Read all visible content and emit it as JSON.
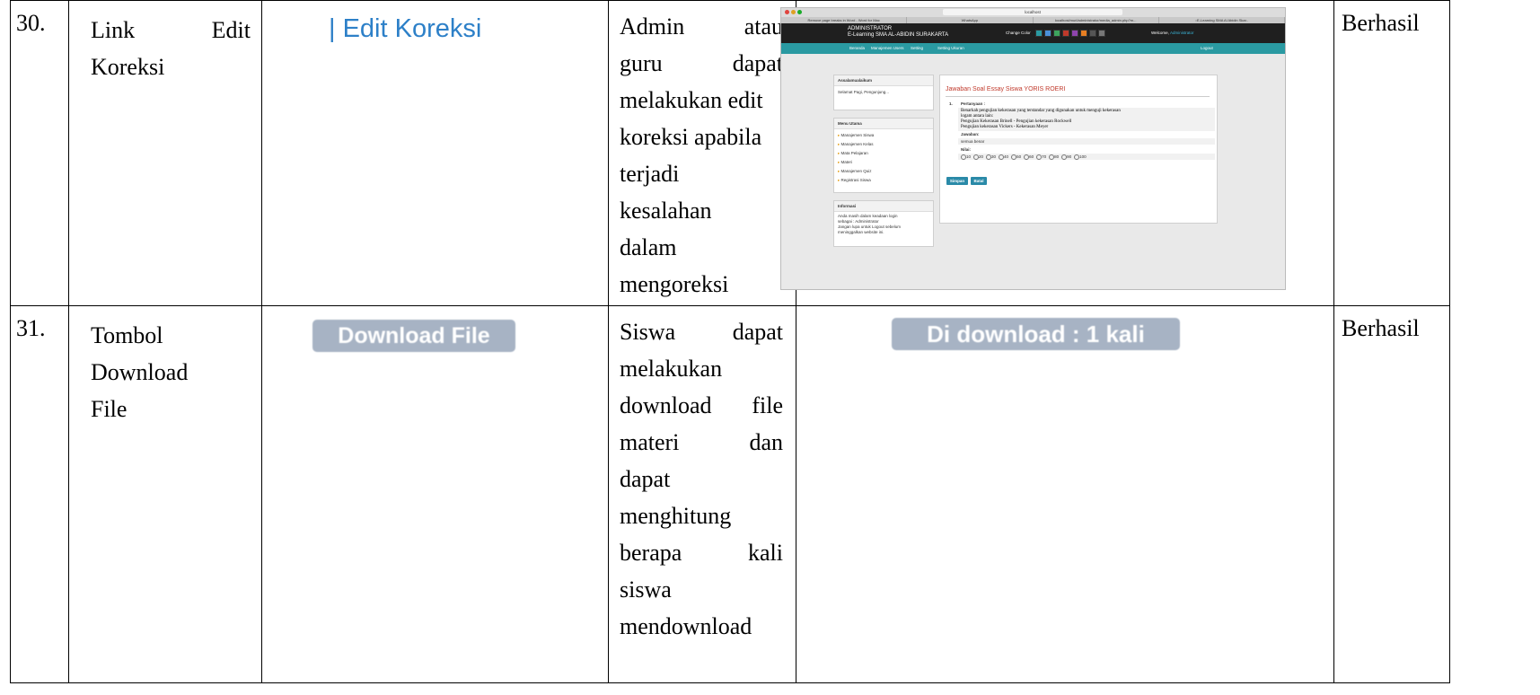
{
  "rows": [
    {
      "no": "30.",
      "name_line1_a": "Link",
      "name_line1_b": "Edit",
      "name_line2": "Koreksi",
      "image_text": "| Edit Koreksi",
      "desc": [
        {
          "a": "Admin",
          "b": "atau"
        },
        {
          "a": "guru",
          "b": "dapat"
        },
        {
          "a": "melakukan edit"
        },
        {
          "a": "koreksi apabila"
        },
        {
          "a": "terjadi"
        },
        {
          "a": "kesalahan"
        },
        {
          "a": "dalam"
        },
        {
          "a": "mengoreksi"
        }
      ],
      "result": "Berhasil"
    },
    {
      "no": "31.",
      "name_lines": [
        "Tombol",
        "Download",
        "File"
      ],
      "image_text": "Download File",
      "desc": [
        {
          "a": "Siswa",
          "b": "dapat"
        },
        {
          "a": "melakukan"
        },
        {
          "a": "download",
          "b": "file"
        },
        {
          "a": "materi",
          "b": "dan"
        },
        {
          "a": "dapat"
        },
        {
          "a": "menghitung"
        },
        {
          "a": "berapa",
          "b": "kali"
        },
        {
          "a": "siswa"
        },
        {
          "a": "mendownload"
        }
      ],
      "shot_text": "Di download : 1 kali",
      "result": "Berhasil"
    }
  ],
  "screenshot": {
    "browser_url": "localhost",
    "tabs": [
      "Remove page breaks in Word - Word for Mac",
      "WhatsApp",
      "localhost/murl/administrator/media_admin.php?m...",
      "::E-Learning SMA Al Abidin Skar.."
    ],
    "header_title": "ADMINISTRATOR",
    "header_sub": "E-Learning SMA AL-ABIDIN SURAKARTA",
    "change_color": "Change Color",
    "welcome": "Welcome,",
    "welcome_user": "Administrator",
    "nav": [
      "Beranda",
      "Manajemen Users",
      "Setting",
      "Setting Ukuran"
    ],
    "logout": "Logout",
    "box1_title": "Assalamualaikum",
    "box1_text": "Selamat Pagi, Pengunjung...",
    "box2_title": "Menu Utama",
    "menu": [
      "Manajemen Siswa",
      "Manajemen Kelas",
      "Mata Pelajaran",
      "Materi",
      "Manajemen Quiz",
      "Registrasi Siswa"
    ],
    "box3_title": "Informasi",
    "info_lines": [
      "Anda masih dalam keadaan login",
      "sebagai : Administrator",
      "Jangan lupa untuk Logout sebelum",
      "meninggalkan website ini."
    ],
    "main_title": "Jawaban Soal Essay Siswa YORIS ROERI",
    "q_label": "1.",
    "q_heading": "Pertanyaan :",
    "q_lines": [
      "Benarkah pengujian kekerasan yang terstandar yang digunakan untuk menguji kekerasan",
      "logam antara lain:",
      "Pengujian Kekerasan Brinell - Pengujian kekerasan Rockwell",
      "Pengujian kekerasan Vickers - Kekerasan Meyer"
    ],
    "answer_label": "Jawaban:",
    "answer": "semua benar",
    "score_label": "Nilai:",
    "scores": [
      "10",
      "20",
      "30",
      "40",
      "50",
      "60",
      "70",
      "80",
      "90",
      "100"
    ],
    "btn_save": "Simpan",
    "btn_cancel": "Batal",
    "colors": {
      "header": "#1f1f1f",
      "nav": "#2a9aa2",
      "title_red": "#c0392b",
      "button": "#2a8aa8"
    }
  }
}
